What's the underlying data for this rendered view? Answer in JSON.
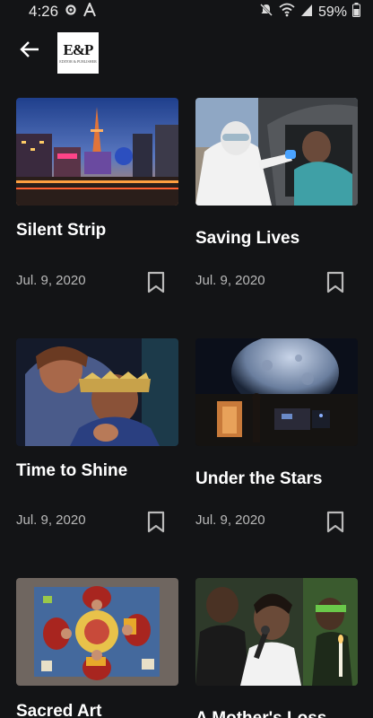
{
  "status_bar": {
    "time": "4:26",
    "battery": "59%",
    "icons": [
      "gear-icon",
      "autofill-a-icon",
      "mute-icon",
      "wifi-icon",
      "signal-icon",
      "battery-icon"
    ]
  },
  "header": {
    "back_icon": "arrow-left-icon",
    "logo": {
      "mark": "E&P",
      "subtitle": "EDITOR & PUBLISHER"
    }
  },
  "colors": {
    "background": "#131416",
    "title": "#ffffff",
    "date": "#b9b9b9",
    "bookmark": "#b9b9b9"
  },
  "articles": [
    {
      "title": "Silent Strip",
      "date": "Jul. 9, 2020",
      "image": "las-vegas-strip-night"
    },
    {
      "title": "Saving Lives",
      "date": "Jul. 9, 2020",
      "image": "covid-test-drive-through"
    },
    {
      "title": "Time to Shine",
      "date": "Jul. 9, 2020",
      "image": "embracing-couple"
    },
    {
      "title": "Under the Stars",
      "date": "Jul. 9, 2020",
      "image": "planetarium-moon"
    },
    {
      "title": "Sacred Art",
      "date": "",
      "image": "monks-sand-mandala"
    },
    {
      "title": "A Mother's Loss",
      "date": "",
      "image": "protest-speaker"
    }
  ]
}
